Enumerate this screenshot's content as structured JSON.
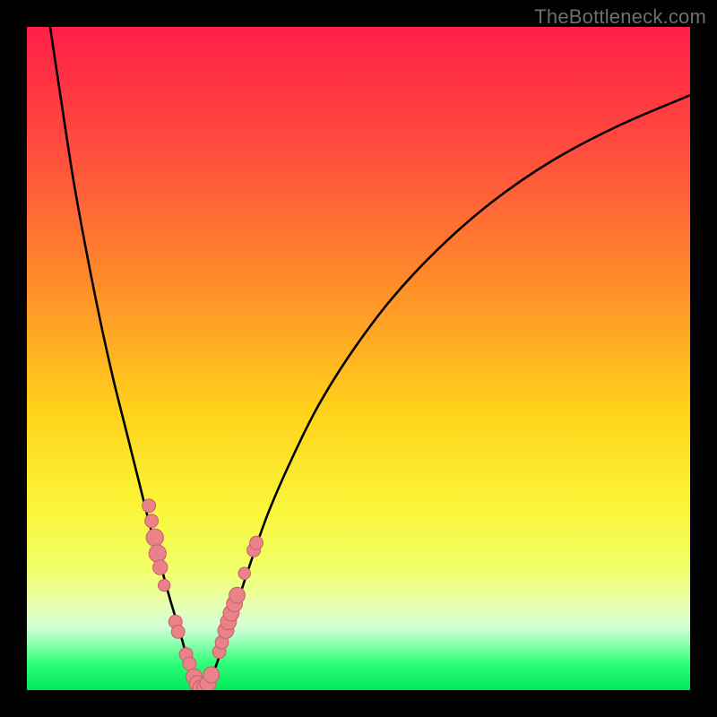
{
  "watermark": "TheBottleneck.com",
  "colors": {
    "frame": "#000000",
    "watermark": "#6f6f6f",
    "gradient_stops": [
      {
        "offset": 0.0,
        "color": "#ff1f47"
      },
      {
        "offset": 0.18,
        "color": "#ff4b3e"
      },
      {
        "offset": 0.38,
        "color": "#ff8a2a"
      },
      {
        "offset": 0.58,
        "color": "#ffd21a"
      },
      {
        "offset": 0.73,
        "color": "#faf73a"
      },
      {
        "offset": 0.82,
        "color": "#f1ff6a"
      },
      {
        "offset": 0.87,
        "color": "#e8ffb0"
      },
      {
        "offset": 0.905,
        "color": "#d3ffd7"
      },
      {
        "offset": 0.93,
        "color": "#8cffb0"
      },
      {
        "offset": 0.96,
        "color": "#2dff76"
      },
      {
        "offset": 1.0,
        "color": "#00e85a"
      }
    ],
    "curve": "#000000",
    "marker_fill": "#e98389",
    "marker_stroke": "#c9636b"
  },
  "chart_data": {
    "type": "line",
    "title": "",
    "xlabel": "",
    "ylabel": "",
    "xlim": [
      0,
      100
    ],
    "ylim": [
      0,
      100
    ],
    "grid": false,
    "series": [
      {
        "name": "bottleneck-curve",
        "x": [
          3.5,
          5,
          7,
          9,
          11,
          13,
          15,
          17,
          18.5,
          20,
          21.5,
          23,
          24,
          25,
          25.8,
          26.5,
          27.3,
          28.2,
          30,
          32,
          34,
          36.5,
          40,
          44,
          49,
          55,
          62,
          70,
          79,
          89,
          100
        ],
        "y": [
          100,
          90,
          77,
          66,
          56,
          47,
          39,
          31,
          25,
          19.5,
          14,
          9,
          5.5,
          2.7,
          0.9,
          0.2,
          0.9,
          2.8,
          8,
          14,
          20,
          27,
          35,
          43,
          51,
          59,
          66.5,
          73.5,
          79.7,
          85,
          89.7
        ]
      }
    ],
    "markers": [
      {
        "x": 18.4,
        "y": 27.8,
        "r": 1.0
      },
      {
        "x": 18.8,
        "y": 25.5,
        "r": 1.0
      },
      {
        "x": 19.3,
        "y": 23.0,
        "r": 1.3
      },
      {
        "x": 19.7,
        "y": 20.6,
        "r": 1.3
      },
      {
        "x": 20.1,
        "y": 18.5,
        "r": 1.1
      },
      {
        "x": 20.7,
        "y": 15.8,
        "r": 0.9
      },
      {
        "x": 22.4,
        "y": 10.3,
        "r": 1.0
      },
      {
        "x": 22.8,
        "y": 8.8,
        "r": 1.0
      },
      {
        "x": 24.0,
        "y": 5.4,
        "r": 1.0
      },
      {
        "x": 24.5,
        "y": 4.0,
        "r": 1.0
      },
      {
        "x": 25.2,
        "y": 2.0,
        "r": 1.2
      },
      {
        "x": 25.7,
        "y": 1.0,
        "r": 1.2
      },
      {
        "x": 26.2,
        "y": 0.3,
        "r": 1.2
      },
      {
        "x": 26.8,
        "y": 0.3,
        "r": 1.2
      },
      {
        "x": 27.3,
        "y": 1.0,
        "r": 1.2
      },
      {
        "x": 27.8,
        "y": 2.3,
        "r": 1.2
      },
      {
        "x": 29.0,
        "y": 5.8,
        "r": 1.0
      },
      {
        "x": 29.4,
        "y": 7.2,
        "r": 1.0
      },
      {
        "x": 30.0,
        "y": 9.0,
        "r": 1.2
      },
      {
        "x": 30.4,
        "y": 10.3,
        "r": 1.2
      },
      {
        "x": 30.8,
        "y": 11.6,
        "r": 1.2
      },
      {
        "x": 31.3,
        "y": 13.0,
        "r": 1.2
      },
      {
        "x": 31.7,
        "y": 14.3,
        "r": 1.2
      },
      {
        "x": 32.8,
        "y": 17.6,
        "r": 0.9
      },
      {
        "x": 34.2,
        "y": 21.1,
        "r": 1.0
      },
      {
        "x": 34.6,
        "y": 22.2,
        "r": 1.0
      }
    ],
    "notes": "x axis and y axis are unlabeled percentages (0–100). Curve is a V-shaped bottleneck profile with minimum at roughly x≈26.5, y≈0. Markers are pink dots clustered on both arms of the V near the minimum."
  }
}
